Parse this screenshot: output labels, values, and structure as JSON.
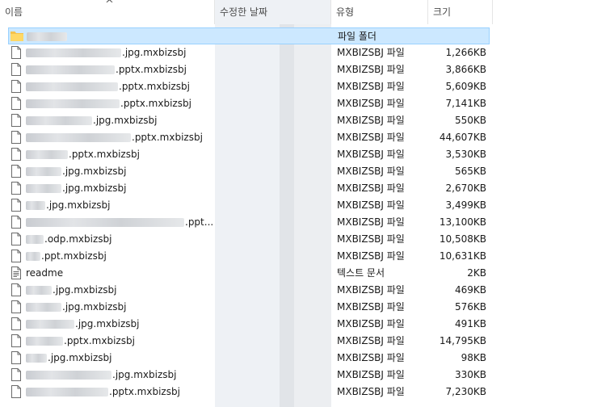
{
  "columns": {
    "name": "이름",
    "date": "수정한 날짜",
    "type": "유형",
    "size": "크기"
  },
  "sort_indicator": "^",
  "rows": [
    {
      "kind": "folder",
      "blur": 50,
      "name": "",
      "type": "파일 폴더",
      "size": "",
      "selected": true
    },
    {
      "kind": "file",
      "blur": 118,
      "name": ".jpg.mxbizsbj",
      "type": "MXBIZSBJ 파일",
      "size": "1,266KB"
    },
    {
      "kind": "file",
      "blur": 110,
      "name": ".pptx.mxbizsbj",
      "type": "MXBIZSBJ 파일",
      "size": "3,866KB"
    },
    {
      "kind": "file",
      "blur": 114,
      "name": ".pptx.mxbizsbj",
      "type": "MXBIZSBJ 파일",
      "size": "5,609KB"
    },
    {
      "kind": "file",
      "blur": 116,
      "name": ".pptx.mxbizsbj",
      "type": "MXBIZSBJ 파일",
      "size": "7,141KB"
    },
    {
      "kind": "file",
      "blur": 82,
      "name": ".jpg.mxbizsbj",
      "type": "MXBIZSBJ 파일",
      "size": "550KB"
    },
    {
      "kind": "file",
      "blur": 130,
      "name": ".pptx.mxbizsbj",
      "type": "MXBIZSBJ 파일",
      "size": "44,607KB"
    },
    {
      "kind": "file",
      "blur": 52,
      "name": ".pptx.mxbizsbj",
      "type": "MXBIZSBJ 파일",
      "size": "3,530KB"
    },
    {
      "kind": "file",
      "blur": 44,
      "name": ".jpg.mxbizsbj",
      "type": "MXBIZSBJ 파일",
      "size": "565KB"
    },
    {
      "kind": "file",
      "blur": 44,
      "name": ".jpg.mxbizsbj",
      "type": "MXBIZSBJ 파일",
      "size": "2,670KB"
    },
    {
      "kind": "file",
      "blur": 24,
      "name": ".jpg.mxbizsbj",
      "type": "MXBIZSBJ 파일",
      "size": "3,499KB"
    },
    {
      "kind": "file",
      "blur": 196,
      "name": ".ppt...",
      "type": "MXBIZSBJ 파일",
      "size": "13,100KB"
    },
    {
      "kind": "file",
      "blur": 22,
      "name": ".odp.mxbizsbj",
      "type": "MXBIZSBJ 파일",
      "size": "10,508KB"
    },
    {
      "kind": "file",
      "blur": 18,
      "name": ".ppt.mxbizsbj",
      "type": "MXBIZSBJ 파일",
      "size": "10,631KB"
    },
    {
      "kind": "text",
      "blur": 0,
      "name": "readme",
      "type": "텍스트 문서",
      "size": "2KB"
    },
    {
      "kind": "file",
      "blur": 32,
      "name": ".jpg.mxbizsbj",
      "type": "MXBIZSBJ 파일",
      "size": "469KB"
    },
    {
      "kind": "file",
      "blur": 44,
      "name": ".jpg.mxbizsbj",
      "type": "MXBIZSBJ 파일",
      "size": "576KB"
    },
    {
      "kind": "file",
      "blur": 60,
      "name": ".jpg.mxbizsbj",
      "type": "MXBIZSBJ 파일",
      "size": "491KB"
    },
    {
      "kind": "file",
      "blur": 46,
      "name": ".pptx.mxbizsbj",
      "type": "MXBIZSBJ 파일",
      "size": "14,795KB"
    },
    {
      "kind": "file",
      "blur": 26,
      "name": ".jpg.mxbizsbj",
      "type": "MXBIZSBJ 파일",
      "size": "98KB"
    },
    {
      "kind": "file",
      "blur": 106,
      "name": ".jpg.mxbizsbj",
      "type": "MXBIZSBJ 파일",
      "size": "330KB"
    },
    {
      "kind": "file",
      "blur": 102,
      "name": ".pptx.mxbizsbj",
      "type": "MXBIZSBJ 파일",
      "size": "7,230KB"
    }
  ]
}
